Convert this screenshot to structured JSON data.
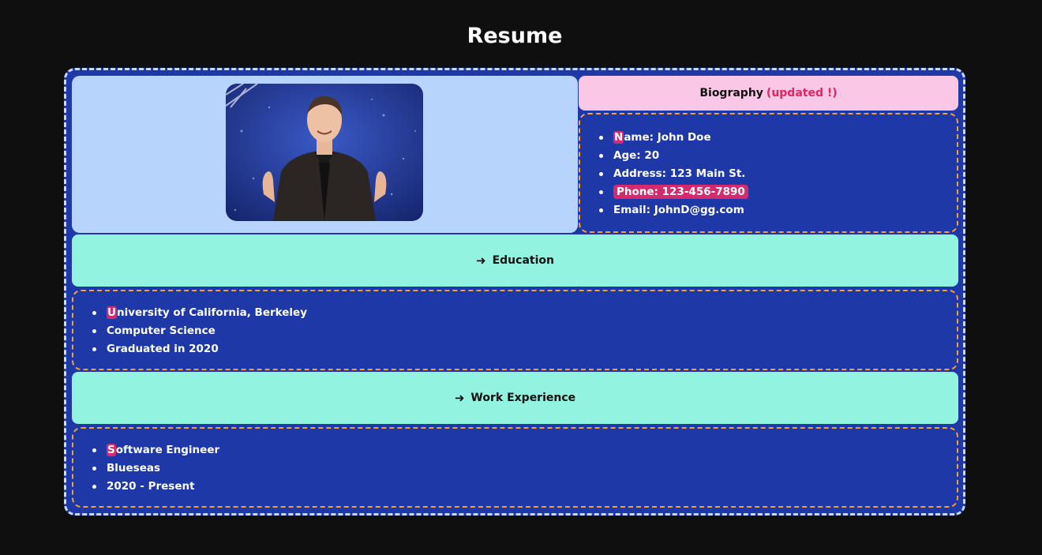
{
  "page": {
    "title": "Resume"
  },
  "biography": {
    "header_label": "Biography",
    "updated_label": "(updated !)",
    "items": [
      {
        "first": "N",
        "rest": "ame: John Doe"
      },
      {
        "text": "Age: 20"
      },
      {
        "text": "Address: 123 Main St."
      },
      {
        "text": "Phone: 123-456-7890"
      },
      {
        "text": "Email: JohnD@gg.com"
      }
    ]
  },
  "education": {
    "arrow_icon": "➜",
    "header_label": "Education",
    "items": [
      {
        "first": "U",
        "rest": "niversity of California, Berkeley"
      },
      {
        "text": "Computer Science"
      },
      {
        "text": "Graduated in 2020"
      }
    ]
  },
  "work": {
    "arrow_icon": "➜",
    "header_label": "Work Experience",
    "items": [
      {
        "first": "S",
        "rest": "oftware Engineer"
      },
      {
        "text": "Blueseas"
      },
      {
        "text": "2020 - Present"
      }
    ]
  },
  "colors": {
    "background": "#0f0f0f",
    "frame": "#1e38a8",
    "photo_panel": "#b6d4fc",
    "bio_header": "#fbc7e7",
    "section_header": "#92f3e0",
    "highlight": "#d62a6f",
    "dashed_border": "#f2a13a"
  },
  "icons": {
    "list_bullet": "bullet-dot",
    "section_arrow": "right-arrow-icon"
  }
}
